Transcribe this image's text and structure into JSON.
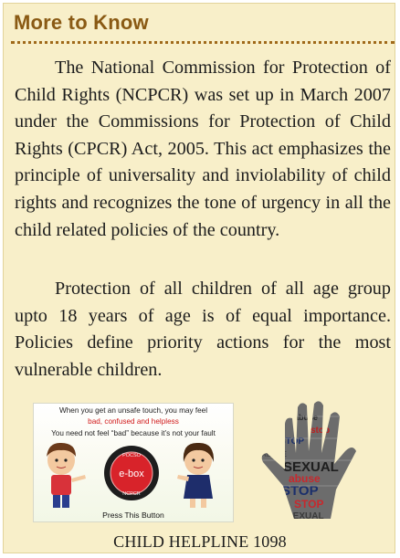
{
  "heading": "More to Know",
  "paragraphs": [
    "The National Commission for Protection of Child Rights (NCPCR) was set up in March 2007 under the Commissions for Protection of Child Rights (CPCR) Act, 2005. This act emphasizes the principle of universality and inviolability of child rights and recognizes the tone of urgency in all the child related policies of the country.",
    "Protection of all children of all age group upto 18 years of age is of equal importance. Policies define priority actions for the most vulnerable children."
  ],
  "image_left": {
    "line1": "When you get an unsafe touch, you may feel",
    "line2": "bad, confused and helpless",
    "line3": "You need not feel “bad” because it’s not your fault",
    "badge_top": "POCSO",
    "badge_center": "e-box",
    "badge_bottom": "NCPCR",
    "caption": "Press This Button"
  },
  "image_right": {
    "words": [
      "SEXUAL",
      "abuse",
      "stop",
      "STOP",
      "ABUSE",
      "SEXUAL",
      "abuse",
      "STOP",
      "STOP",
      "SEXUAL"
    ]
  },
  "helpline": "CHILD HELPLINE 1098",
  "colors": {
    "box_bg": "#f8efc9",
    "heading": "#8a5a14",
    "badge_red": "#d8232a"
  }
}
